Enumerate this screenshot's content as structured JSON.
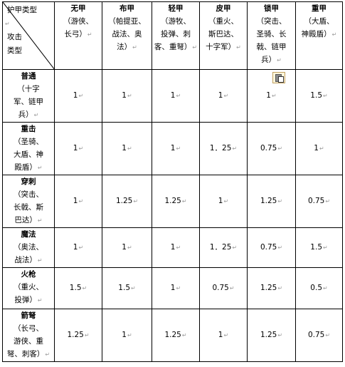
{
  "corner": {
    "armor_label": "护甲类型",
    "attack_label_1": "攻击",
    "attack_label_2": "类型"
  },
  "para_mark": "↵",
  "armor_types": [
    {
      "name": "无甲",
      "sub": [
        "（游侠、",
        "长弓）"
      ]
    },
    {
      "name": "布甲",
      "sub": [
        "（帕提亚、",
        "战法、奥",
        "法）"
      ]
    },
    {
      "name": "轻甲",
      "sub": [
        "（游牧、",
        "投弹、刺",
        "客、重弩）"
      ]
    },
    {
      "name": "皮甲",
      "sub": [
        "（重火、",
        "斯巴达、",
        "十字军）"
      ]
    },
    {
      "name": "锁甲",
      "sub": [
        "（突击、",
        "圣骑、长",
        "戟、链甲",
        "兵）"
      ]
    },
    {
      "name": "重甲",
      "sub": [
        "（大盾、",
        "神殿盾）"
      ]
    }
  ],
  "attack_types": [
    {
      "name": "普通",
      "sub": [
        "（十字",
        "军、链甲",
        "兵）"
      ],
      "values": [
        "1",
        "1",
        "1",
        "1",
        "1",
        "1.5"
      ]
    },
    {
      "name": "重击",
      "sub": [
        "（圣骑、",
        "大盾、神",
        "殿盾）"
      ],
      "values": [
        "1",
        "1",
        "1",
        "1．25",
        "0.75",
        "1"
      ]
    },
    {
      "name": "穿刺",
      "sub": [
        "（突击、",
        "长戟、斯",
        "巴达）"
      ],
      "values": [
        "1",
        "1.25",
        "1.25",
        "1",
        "1.25",
        "0.75"
      ]
    },
    {
      "name": "魔法",
      "sub": [
        "（奥法、",
        "战法）"
      ],
      "values": [
        "1",
        "1",
        "1",
        "1．25",
        "0.75",
        "1.5"
      ]
    },
    {
      "name": "火枪",
      "sub": [
        "（重火、",
        "投弹）"
      ],
      "values": [
        "1.5",
        "1.5",
        "1",
        "0.75",
        "1.25",
        "0.5"
      ]
    },
    {
      "name": "箭弩",
      "sub": [
        "（长弓、",
        "游侠、重",
        "弩、刺客）"
      ],
      "values": [
        "1.25",
        "1",
        "1.25",
        "1",
        "1.25",
        "0.75"
      ]
    }
  ]
}
